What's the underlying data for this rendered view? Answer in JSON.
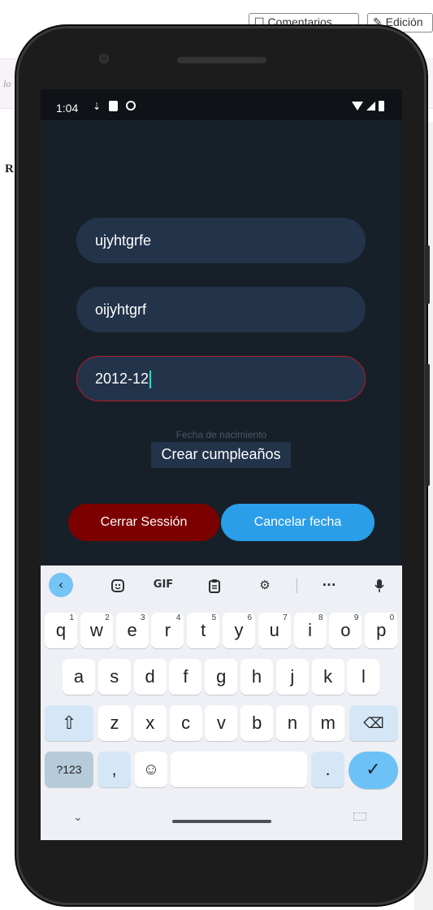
{
  "background": {
    "comments_label": "☐ Comentarios",
    "edit_label": "✎ Edición",
    "italic_fragment": "lo",
    "bold_fragment": "R"
  },
  "status_bar": {
    "time": "1:04",
    "icons_left": [
      "download-icon",
      "sd-card-icon",
      "sync-icon"
    ],
    "icons_right": [
      "wifi-icon",
      "signal-icon",
      "battery-icon"
    ]
  },
  "form": {
    "field1_value": "ujyhtgrfe",
    "field2_value": "oijyhtgrf",
    "date_value": "2012-12",
    "date_hint": "Fecha de nacimiento",
    "create_label": "Crear cumpleaños",
    "logout_label": "Cerrar Sessión",
    "cancel_label": "Cancelar fecha"
  },
  "keyboard": {
    "toolbar": [
      "back-icon",
      "sticker-icon",
      "GIF",
      "clipboard-icon",
      "settings-icon",
      "more-icon",
      "mic-icon"
    ],
    "gif_label": "GIF",
    "more_label": "···",
    "row1": [
      {
        "k": "q",
        "s": "1"
      },
      {
        "k": "w",
        "s": "2"
      },
      {
        "k": "e",
        "s": "3"
      },
      {
        "k": "r",
        "s": "4"
      },
      {
        "k": "t",
        "s": "5"
      },
      {
        "k": "y",
        "s": "6"
      },
      {
        "k": "u",
        "s": "7"
      },
      {
        "k": "i",
        "s": "8"
      },
      {
        "k": "o",
        "s": "9"
      },
      {
        "k": "p",
        "s": "0"
      }
    ],
    "row2": [
      "a",
      "s",
      "d",
      "f",
      "g",
      "h",
      "j",
      "k",
      "l"
    ],
    "row3": [
      "z",
      "x",
      "c",
      "v",
      "b",
      "n",
      "m"
    ],
    "num_label": "?123",
    "comma_label": ",",
    "period_label": "."
  },
  "colors": {
    "app_bg": "#172028",
    "field_bg": "#22334a",
    "error_border": "#b11e2a",
    "logout_bg": "#7d0000",
    "cancel_bg": "#2a9ee8",
    "caret": "#36d6c2"
  }
}
